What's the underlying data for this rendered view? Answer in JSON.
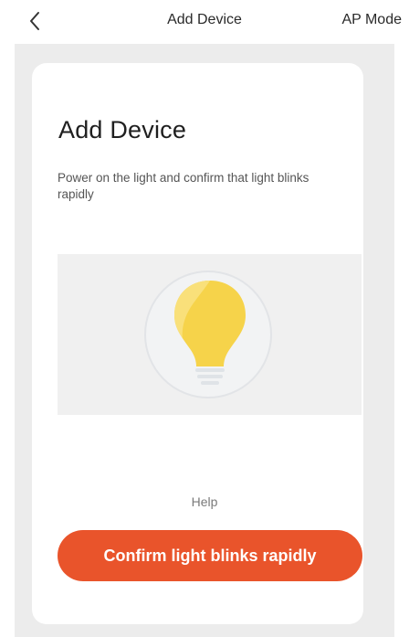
{
  "navbar": {
    "title": "Add Device",
    "right_action": "AP Mode"
  },
  "card": {
    "title": "Add Device",
    "description": "Power on the light and confirm that light blinks  rapidly"
  },
  "help": {
    "label": "Help"
  },
  "confirm_button": {
    "label": "Confirm light blinks rapidly"
  },
  "icons": {
    "back": "chevron-left-icon",
    "illustration": "light-bulb-icon"
  },
  "colors": {
    "accent": "#e9542b",
    "bulb": "#f6d34a",
    "background": "#ececec"
  }
}
